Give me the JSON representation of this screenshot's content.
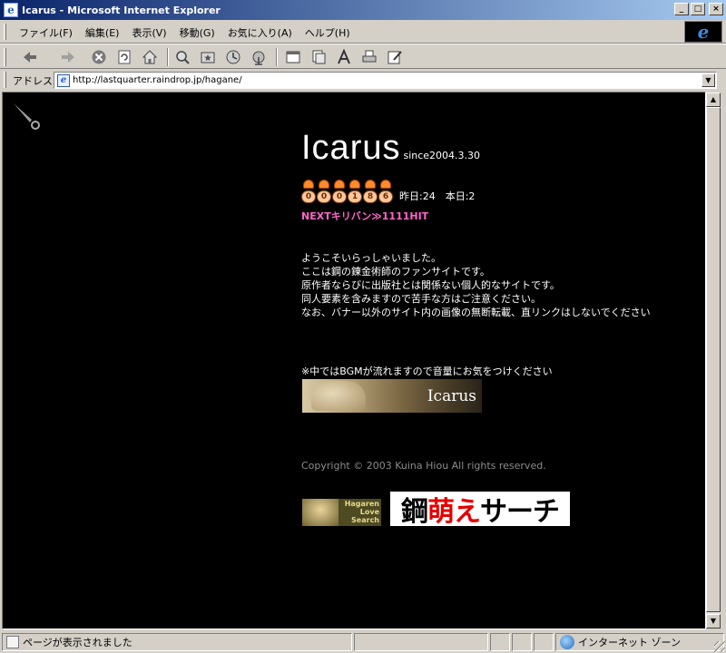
{
  "window": {
    "title": "Icarus - Microsoft Internet Explorer",
    "min_glyph": "_",
    "max_glyph": "□",
    "close_glyph": "×"
  },
  "menu": {
    "items": [
      "ファイル(F)",
      "編集(E)",
      "表示(V)",
      "移動(G)",
      "お気に入り(A)",
      "ヘルプ(H)"
    ]
  },
  "toolbar": {
    "buttons": [
      "back-icon",
      "forward-icon",
      "stop-icon",
      "refresh-icon",
      "home-icon",
      "search-icon",
      "favorites-icon",
      "history-icon",
      "channels-icon",
      "fullscreen-icon",
      "mail-icon",
      "font-icon",
      "print-icon",
      "edit-icon"
    ]
  },
  "address": {
    "label": "アドレス",
    "url": "http://lastquarter.raindrop.jp/hagane/"
  },
  "page": {
    "title": "Icarus",
    "since": "since2004.3.30",
    "counter_digits": [
      "0",
      "0",
      "0",
      "1",
      "8",
      "6"
    ],
    "counter_text": "昨日:24　本日:2",
    "kiriban": "NEXTキリバン≫1111HIT",
    "welcome_lines": [
      "ようこそいらっしゃいました。",
      "ここは鋼の錬金術師のファンサイトです。",
      "原作者ならびに出版社とは関係ない個人的なサイトです。",
      "同人要素を含みますので苦手な方はご注意ください。",
      "なお、バナー以外のサイト内の画像の無断転載、直リンクはしないでください"
    ],
    "bgm_note": "※中ではBGMが流れますので音量にお気をつけください",
    "enter_banner_label": "Icarus",
    "copyright": "Copyright © 2003 Kuina Hiou All rights reserved.",
    "banner_hls_lines": [
      "Hagaren",
      "Love",
      "Search"
    ],
    "banner_moe": {
      "part1": "鋼",
      "part2": "萌え",
      "part3": "サーチ"
    }
  },
  "status": {
    "text": "ページが表示されました",
    "zone": "インターネット ゾーン"
  },
  "colors": {
    "kiriban": "#ff66cc",
    "content_bg": "#000000",
    "moe_red": "#e60000"
  }
}
